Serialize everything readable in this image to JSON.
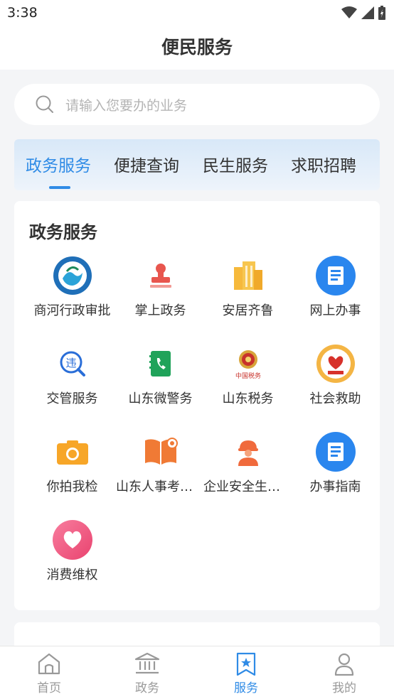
{
  "status_bar": {
    "time": "3:38"
  },
  "header": {
    "title": "便民服务"
  },
  "search": {
    "placeholder": "请输入您要办的业务"
  },
  "tabs": [
    {
      "label": "政务服务",
      "active": true
    },
    {
      "label": "便捷查询",
      "active": false
    },
    {
      "label": "民生服务",
      "active": false
    },
    {
      "label": "求职招聘",
      "active": false
    }
  ],
  "section": {
    "title": "政务服务",
    "items": [
      {
        "label": "商河行政审批",
        "icon": "shanghe-emblem-icon"
      },
      {
        "label": "掌上政务",
        "icon": "seal-stamp-icon"
      },
      {
        "label": "安居齐鲁",
        "icon": "building-icon"
      },
      {
        "label": "网上办事",
        "icon": "document-icon"
      },
      {
        "label": "交管服务",
        "icon": "traffic-violation-icon"
      },
      {
        "label": "山东微警务",
        "icon": "phone-notebook-icon"
      },
      {
        "label": "山东税务",
        "icon": "tax-emblem-icon"
      },
      {
        "label": "社会救助",
        "icon": "social-aid-icon"
      },
      {
        "label": "你拍我检",
        "icon": "camera-icon"
      },
      {
        "label": "山东人事考试...",
        "icon": "book-badge-icon"
      },
      {
        "label": "企业安全生产...",
        "icon": "worker-helmet-icon"
      },
      {
        "label": "办事指南",
        "icon": "guide-document-icon"
      },
      {
        "label": "消费维权",
        "icon": "heart-icon"
      }
    ]
  },
  "bottom_nav": [
    {
      "label": "首页",
      "icon": "home-icon",
      "active": false
    },
    {
      "label": "政务",
      "icon": "government-building-icon",
      "active": false
    },
    {
      "label": "服务",
      "icon": "bookmark-star-icon",
      "active": true
    },
    {
      "label": "我的",
      "icon": "user-icon",
      "active": false
    }
  ],
  "colors": {
    "accent": "#2f8be6",
    "tab_bg": "#dce9f8",
    "page_bg": "#f4f5f7"
  }
}
